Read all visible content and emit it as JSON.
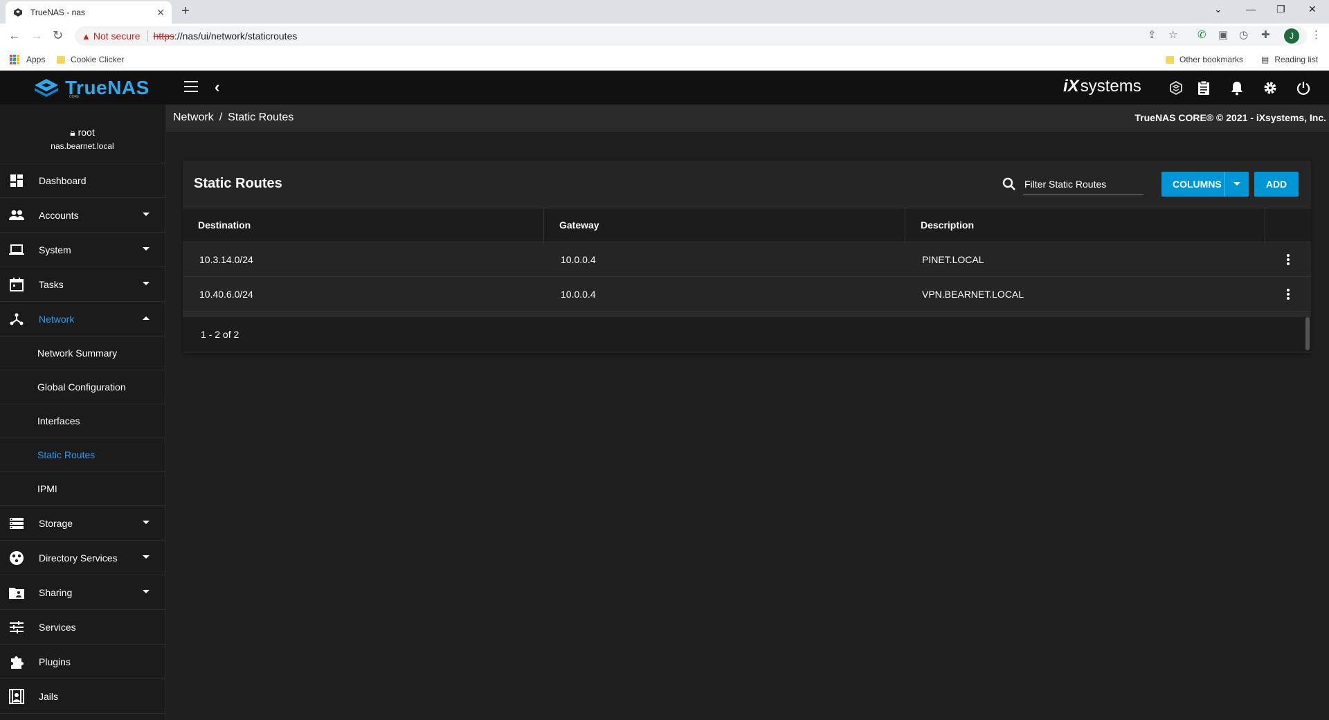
{
  "browser": {
    "tab_title": "TrueNAS - nas",
    "tab_close": "✕",
    "new_tab": "+",
    "not_secure": "Not secure",
    "url_scheme": "https",
    "url_rest": "://nas/ui/network/staticroutes",
    "profile_initial": "J",
    "bookmarks": {
      "apps": "Apps",
      "cookie_clicker": "Cookie Clicker",
      "other_bookmarks": "Other bookmarks",
      "reading_list": "Reading list"
    }
  },
  "app": {
    "logo_text": "TrueNAS",
    "logo_sub": "CORE",
    "ix_logo_prefix": "iX",
    "ix_logo_suffix": "systems",
    "user": {
      "name": "root",
      "host": "nas.bearnet.local"
    },
    "copyright": "TrueNAS CORE® © 2021 - iXsystems, Inc.",
    "breadcrumb": {
      "parent": "Network",
      "sep": "/",
      "current": "Static Routes"
    },
    "nav": {
      "dashboard": "Dashboard",
      "accounts": "Accounts",
      "system": "System",
      "tasks": "Tasks",
      "network": "Network",
      "network_summary": "Network Summary",
      "global_configuration": "Global Configuration",
      "interfaces": "Interfaces",
      "static_routes": "Static Routes",
      "ipmi": "IPMI",
      "storage": "Storage",
      "directory_services": "Directory Services",
      "sharing": "Sharing",
      "services": "Services",
      "plugins": "Plugins",
      "jails": "Jails"
    },
    "accent_color": "#0095d5",
    "active_nav_color": "#2d9bf0"
  },
  "static_routes": {
    "title": "Static Routes",
    "filter_placeholder": "Filter Static Routes",
    "columns_label": "COLUMNS",
    "add_label": "ADD",
    "columns": [
      "Destination",
      "Gateway",
      "Description"
    ],
    "rows": [
      {
        "destination": "10.3.14.0/24",
        "gateway": "10.0.0.4",
        "description": "PINET.LOCAL"
      },
      {
        "destination": "10.40.6.0/24",
        "gateway": "10.0.0.4",
        "description": "VPN.BEARNET.LOCAL"
      }
    ],
    "pagination": "1 - 2 of 2"
  }
}
